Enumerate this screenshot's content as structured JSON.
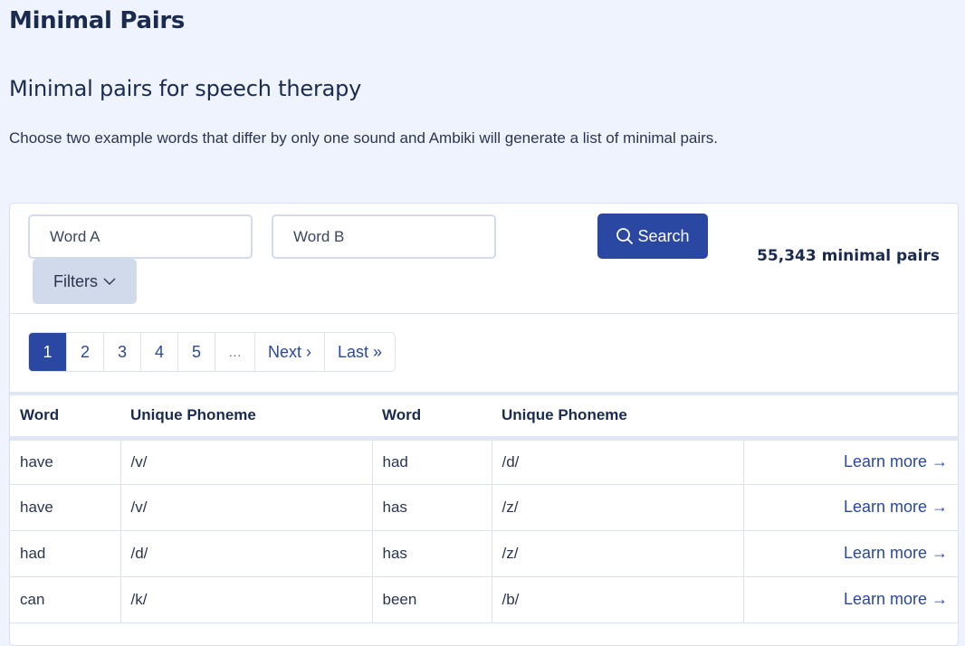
{
  "page": {
    "title": "Minimal Pairs",
    "subtitle": "Minimal pairs for speech therapy",
    "intro": "Choose two example words that differ by only one sound and Ambiki will generate a list of minimal pairs."
  },
  "search": {
    "word_a_placeholder": "Word A",
    "word_a_value": "",
    "word_b_placeholder": "Word B",
    "word_b_value": "",
    "search_label": "Search",
    "search_icon": "search-icon",
    "filters_label": "Filters",
    "filters_icon": "chevron-down-icon",
    "result_count": "55,343 minimal pairs"
  },
  "pagination": {
    "items": [
      {
        "label": "1",
        "active": true
      },
      {
        "label": "2"
      },
      {
        "label": "3"
      },
      {
        "label": "4"
      },
      {
        "label": "5"
      },
      {
        "label": "…"
      },
      {
        "label": "Next ›"
      },
      {
        "label": "Last »"
      }
    ]
  },
  "table": {
    "headers": [
      "Word",
      "Unique Phoneme",
      "Word",
      "Unique Phoneme",
      ""
    ],
    "link_label": "Learn more →",
    "rows": [
      {
        "word1": "have",
        "phoneme1": "/v/",
        "word2": "had",
        "phoneme2": "/d/"
      },
      {
        "word1": "have",
        "phoneme1": "/v/",
        "word2": "has",
        "phoneme2": "/z/"
      },
      {
        "word1": "had",
        "phoneme1": "/d/",
        "word2": "has",
        "phoneme2": "/z/"
      },
      {
        "word1": "can",
        "phoneme1": "/k/",
        "word2": "been",
        "phoneme2": "/b/"
      }
    ]
  },
  "colors": {
    "primary": "#2a47a1",
    "background": "#eef3fd",
    "filters_bg": "#d1daea",
    "text_dark": "#1b2b4f"
  }
}
